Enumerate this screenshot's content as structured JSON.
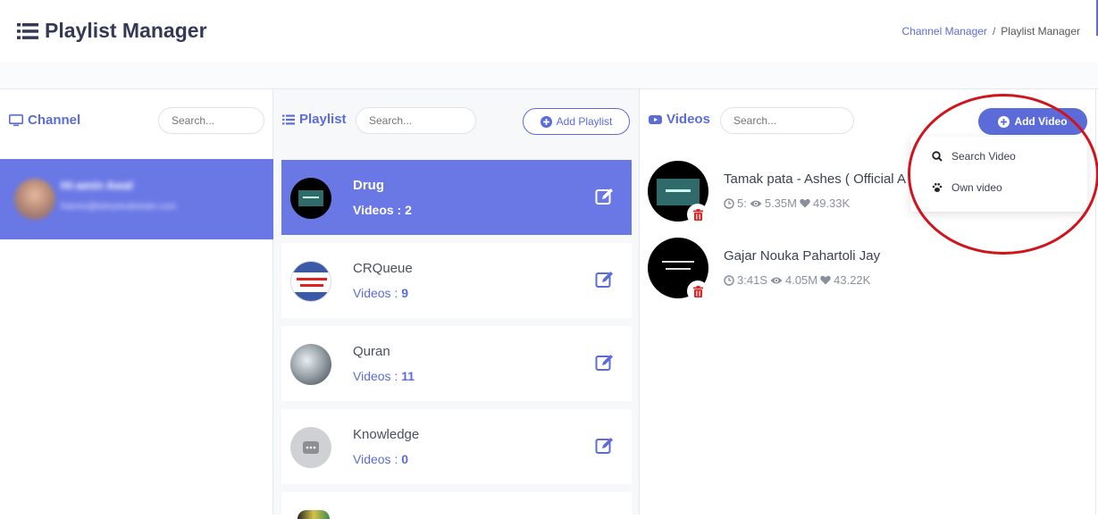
{
  "header": {
    "title": "Playlist Manager",
    "breadcrumb": {
      "link": "Channel Manager",
      "separator": "/",
      "current": "Playlist Manager"
    }
  },
  "channel": {
    "title": "Channel",
    "search_placeholder": "Search...",
    "selected": {
      "name": "Hi-amin Awal",
      "email": "hiamin@bdnystudiotube.com"
    }
  },
  "playlist": {
    "title": "Playlist",
    "search_placeholder": "Search...",
    "add_label": "Add Playlist",
    "videos_label": "Videos :",
    "items": [
      {
        "name": "Drug",
        "count": "2",
        "active": true
      },
      {
        "name": "CRQueue",
        "count": "9",
        "active": false
      },
      {
        "name": "Quran",
        "count": "11",
        "active": false
      },
      {
        "name": "Knowledge",
        "count": "0",
        "active": false
      }
    ]
  },
  "videos": {
    "title": "Videos",
    "search_placeholder": "Search...",
    "add_label": "Add Video",
    "items": [
      {
        "title": "Tamak pata - Ashes ( Official A",
        "duration": "5:",
        "views": "5.35M",
        "likes": "49.33K"
      },
      {
        "title": "Gajar Nouka Pahartoli Jay",
        "duration": "3:41S",
        "views": "4.05M",
        "likes": "43.22K"
      }
    ],
    "dropdown": [
      {
        "label": "Search Video",
        "icon": "search-icon"
      },
      {
        "label": "Own video",
        "icon": "paw-icon"
      }
    ]
  },
  "colors": {
    "accent": "#5b6cd8",
    "active_bg": "#6a78e6",
    "annotation": "#d0141e"
  }
}
